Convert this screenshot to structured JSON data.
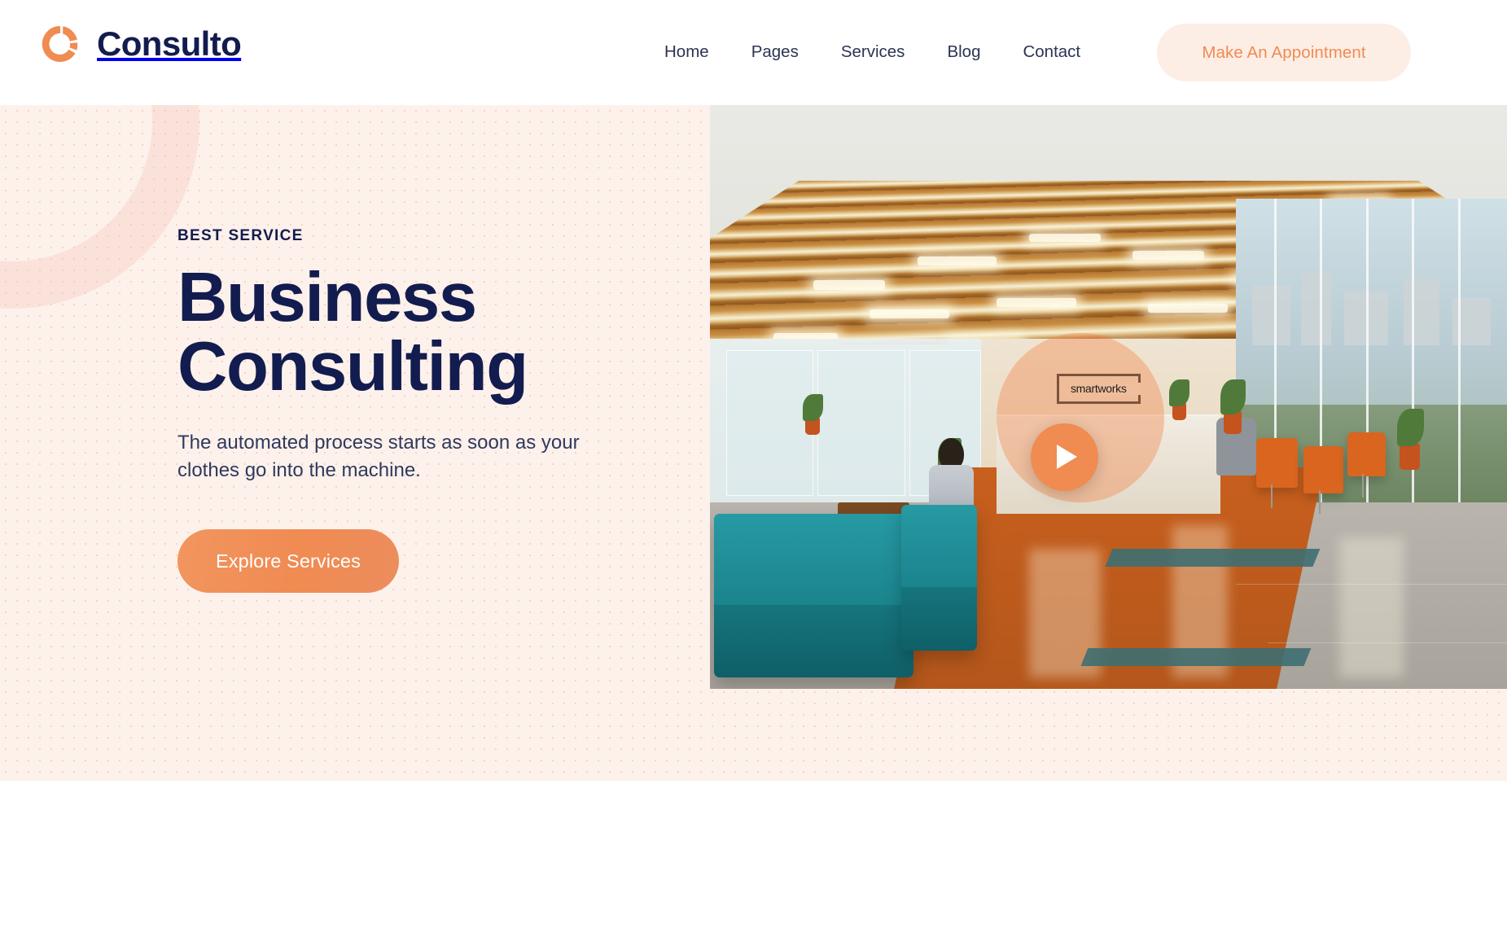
{
  "header": {
    "brand": {
      "name": "Consulto",
      "mark_icon": "donut-ring-logo",
      "mark_color": "#f08b52"
    },
    "nav": [
      {
        "label": "Home"
      },
      {
        "label": "Pages"
      },
      {
        "label": "Services"
      },
      {
        "label": "Blog"
      },
      {
        "label": "Contact"
      }
    ],
    "appointment_button": {
      "label": "Make An Appointment",
      "bg_color": "#fdeee5",
      "text_color": "#f08b52"
    }
  },
  "hero": {
    "eyebrow": "BEST SERVICE",
    "title_line1": "Business",
    "title_line2": "Consulting",
    "subtitle": "The automated process starts as soon as your clothes go into the machine.",
    "cta_label": "Explore Services",
    "bg_color": "#fdf1ec",
    "accent_color": "#f08b52",
    "title_color": "#131c4e",
    "media": {
      "alt": "Modern office reception lounge with teal sofas, orange chairs and wooden slat ceiling",
      "sign_text": "smartworks",
      "play_icon": "play-triangle-icon",
      "play_label": "Play video"
    },
    "decor": {
      "ring_icon": "circle-ring-decoration",
      "dots_icon": "dot-grid-decoration"
    }
  }
}
